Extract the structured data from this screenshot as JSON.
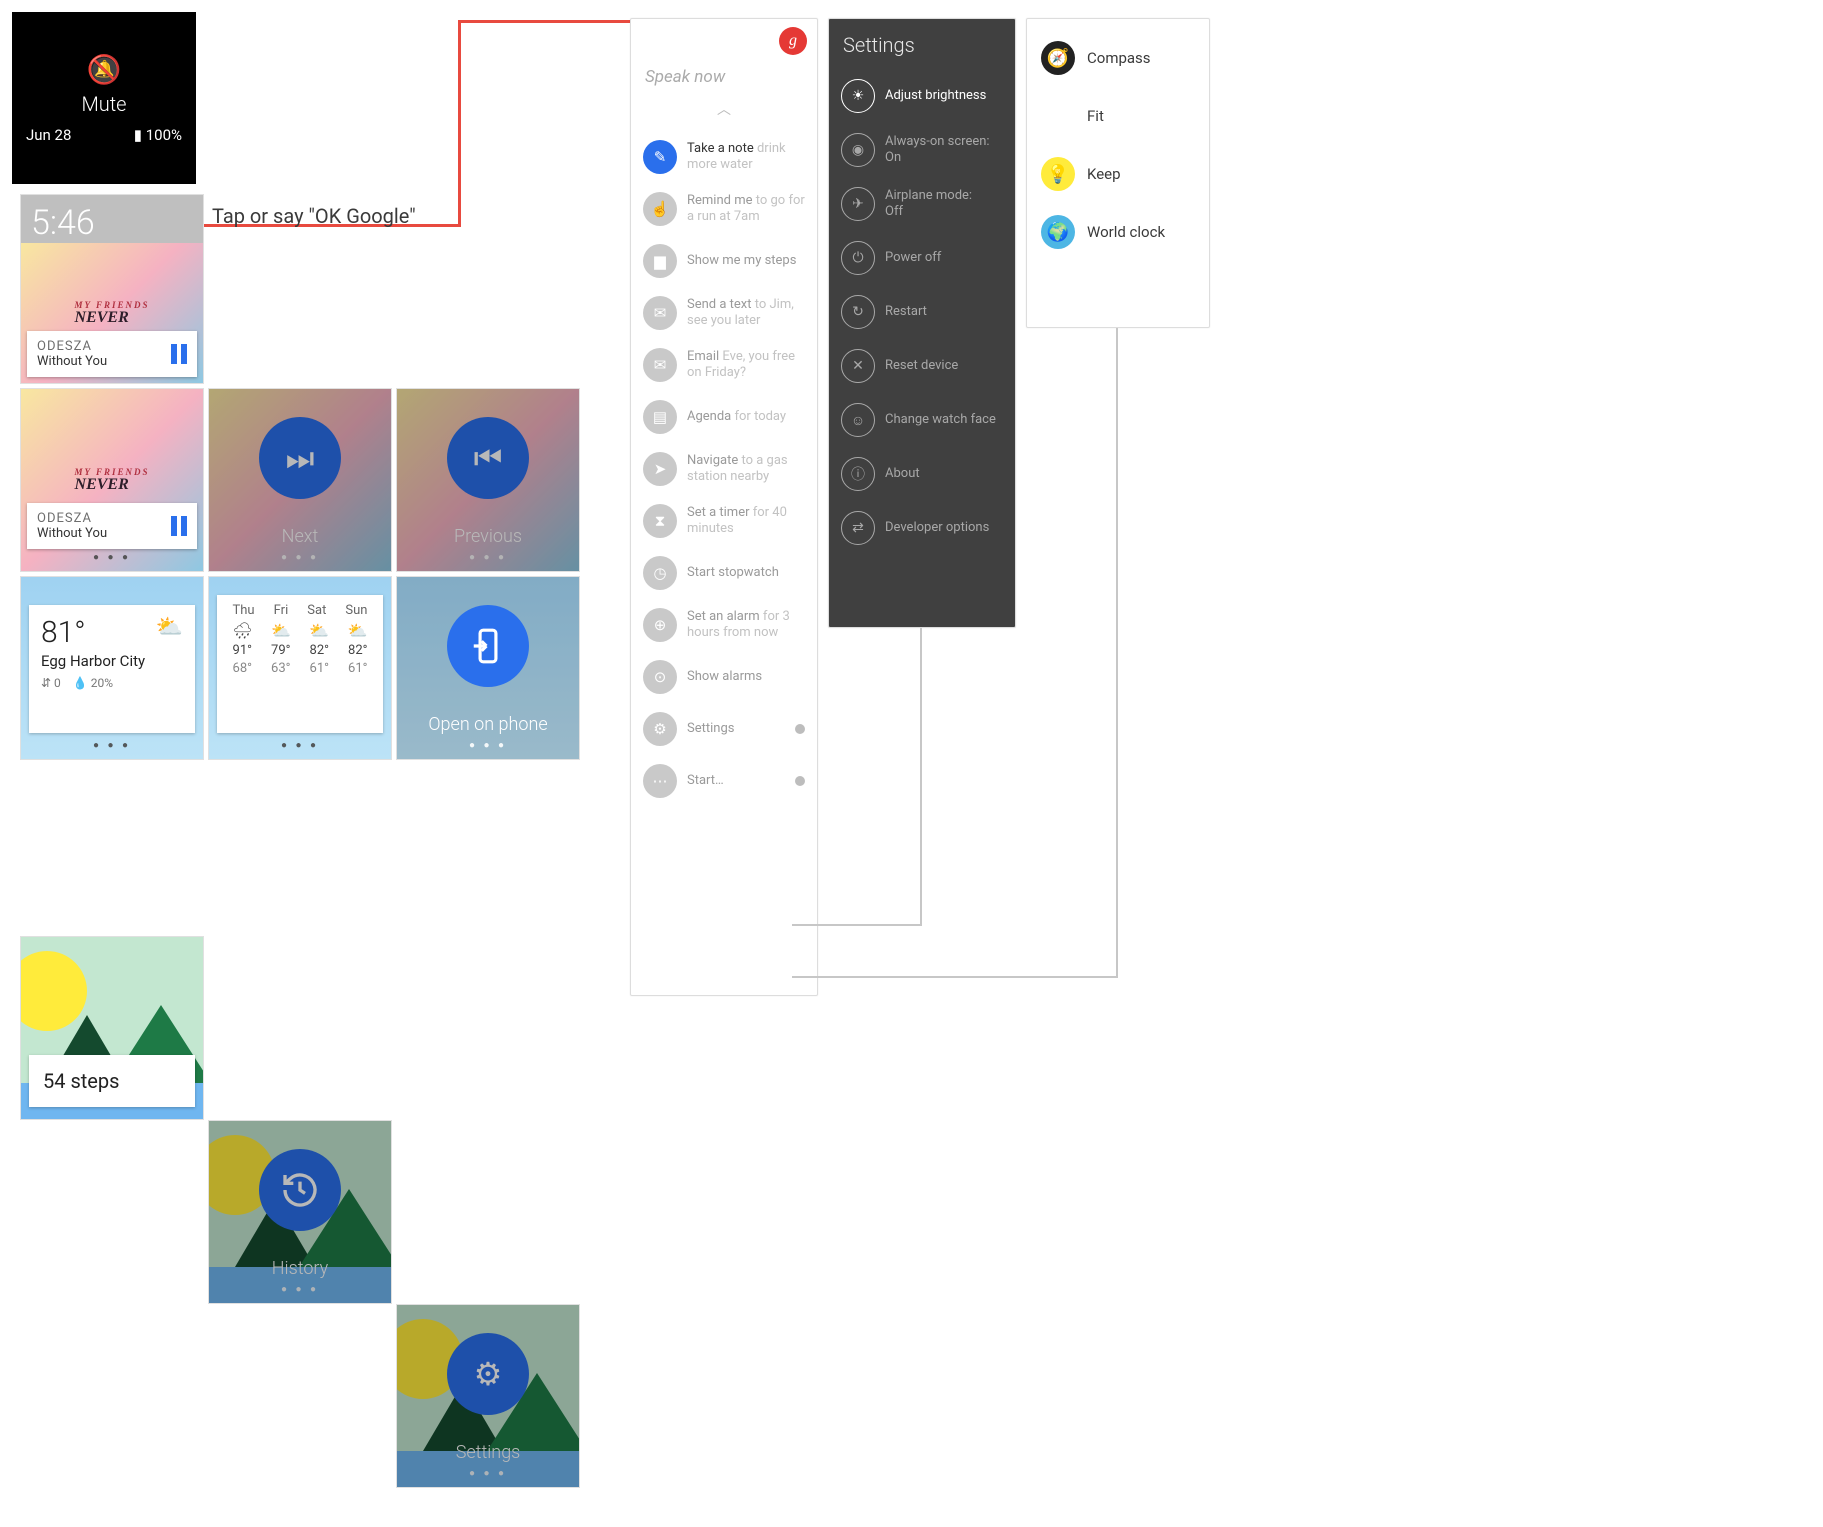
{
  "mute": {
    "label": "Mute",
    "date": "Jun 28",
    "battery": "100%"
  },
  "watch": {
    "time": "5:46",
    "art_super": "MY FRIENDS",
    "art_main": "NEVER",
    "music_artist": "ODESZA",
    "music_track": "Without You"
  },
  "callout": "Tap or say \"OK Google\"",
  "media_tiles": {
    "next": "Next",
    "previous": "Previous",
    "open_on_phone": "Open on phone",
    "history": "History",
    "settings": "Settings"
  },
  "weather": {
    "temp": "81°",
    "city": "Egg Harbor City",
    "wind": "0",
    "humidity": "20%",
    "days": [
      "Thu",
      "Fri",
      "Sat",
      "Sun"
    ],
    "highs": [
      "91°",
      "79°",
      "82°",
      "82°"
    ],
    "lows": [
      "68°",
      "63°",
      "61°",
      "61°"
    ]
  },
  "steps": {
    "label": "54 steps"
  },
  "voice": {
    "speak": "Speak now",
    "items": [
      {
        "icon": "✎",
        "cmd": "Take a note",
        "hint": "drink more water",
        "active": true
      },
      {
        "icon": "☝",
        "cmd": "Remind me",
        "hint": "to go for a run at 7am"
      },
      {
        "icon": "▆",
        "cmd": "Show me my steps",
        "hint": ""
      },
      {
        "icon": "✉",
        "cmd": "Send a text",
        "hint": "to Jim, see you later"
      },
      {
        "icon": "✉",
        "cmd": "Email",
        "hint": "Eve, you free on Friday?"
      },
      {
        "icon": "▤",
        "cmd": "Agenda",
        "hint": "for today"
      },
      {
        "icon": "➤",
        "cmd": "Navigate",
        "hint": "to a gas station nearby"
      },
      {
        "icon": "⧗",
        "cmd": "Set a timer",
        "hint": "for 40 minutes"
      },
      {
        "icon": "◷",
        "cmd": "Start stopwatch",
        "hint": ""
      },
      {
        "icon": "⊕",
        "cmd": "Set an alarm",
        "hint": "for 3 hours from now"
      },
      {
        "icon": "⊙",
        "cmd": "Show alarms",
        "hint": ""
      },
      {
        "icon": "⚙",
        "cmd": "Settings",
        "hint": "",
        "pin": true
      },
      {
        "icon": "⋯",
        "cmd": "Start…",
        "hint": "",
        "pin": true
      }
    ]
  },
  "settings": {
    "title": "Settings",
    "items": [
      {
        "icon": "☀",
        "label": "Adjust brightness",
        "active": true
      },
      {
        "icon": "◉",
        "label": "Always-on screen:",
        "sub": "On"
      },
      {
        "icon": "✈",
        "label": "Airplane mode:",
        "sub": "Off"
      },
      {
        "icon": "⏻",
        "label": "Power off"
      },
      {
        "icon": "↻",
        "label": "Restart"
      },
      {
        "icon": "✕",
        "label": "Reset device"
      },
      {
        "icon": "☺",
        "label": "Change watch face"
      },
      {
        "icon": "ⓘ",
        "label": "About"
      },
      {
        "icon": "⇄",
        "label": "Developer options"
      }
    ]
  },
  "apps": {
    "items": [
      {
        "label": "Compass",
        "bg": "#222",
        "glyph": "🧭"
      },
      {
        "label": "Fit",
        "bg": "#fff",
        "glyph": "❤"
      },
      {
        "label": "Keep",
        "bg": "#ffeb3b",
        "glyph": "💡"
      },
      {
        "label": "World clock",
        "bg": "#4db6e4",
        "glyph": "🌍"
      }
    ]
  }
}
